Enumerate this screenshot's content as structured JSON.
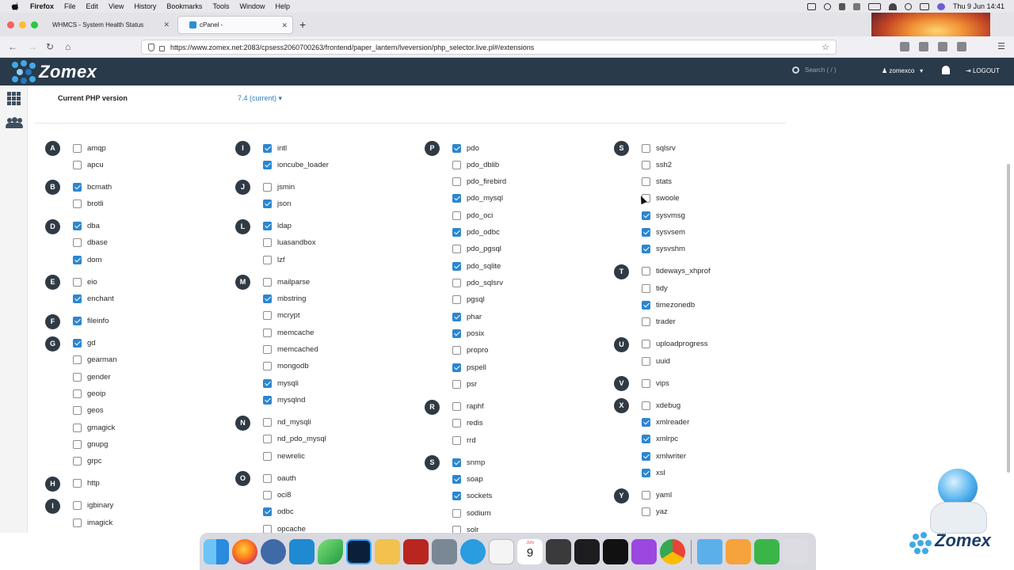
{
  "menubar": {
    "app": "Firefox",
    "items": [
      "File",
      "Edit",
      "View",
      "History",
      "Bookmarks",
      "Tools",
      "Window",
      "Help"
    ],
    "clock": "Thu 9 Jun  14:41"
  },
  "browser": {
    "tabs": [
      {
        "label": "WHMCS - System Health Status",
        "active": false
      },
      {
        "label": "cPanel -",
        "active": true
      }
    ],
    "url": "https://www.zomex.net:2083/cpsess2060700263/frontend/paper_lantern/lveversion/php_selector.live.pl#/extensions"
  },
  "header": {
    "logo": "Zomex",
    "search_placeholder": "Search ( / )",
    "username": "zomexco",
    "logout": "LOGOUT"
  },
  "php": {
    "label": "Current PHP version",
    "value": "7.4 (current)"
  },
  "columns": [
    {
      "groups": [
        {
          "letter": "A",
          "items": [
            {
              "name": "amqp",
              "checked": false
            },
            {
              "name": "apcu",
              "checked": false
            }
          ]
        },
        {
          "letter": "B",
          "items": [
            {
              "name": "bcmath",
              "checked": true
            },
            {
              "name": "brotli",
              "checked": false
            }
          ]
        },
        {
          "letter": "D",
          "items": [
            {
              "name": "dba",
              "checked": true
            },
            {
              "name": "dbase",
              "checked": false
            },
            {
              "name": "dom",
              "checked": true
            }
          ]
        },
        {
          "letter": "E",
          "items": [
            {
              "name": "eio",
              "checked": false
            },
            {
              "name": "enchant",
              "checked": true
            }
          ]
        },
        {
          "letter": "F",
          "items": [
            {
              "name": "fileinfo",
              "checked": true
            }
          ]
        },
        {
          "letter": "G",
          "items": [
            {
              "name": "gd",
              "checked": true
            },
            {
              "name": "gearman",
              "checked": false
            },
            {
              "name": "gender",
              "checked": false
            },
            {
              "name": "geoip",
              "checked": false
            },
            {
              "name": "geos",
              "checked": false
            },
            {
              "name": "gmagick",
              "checked": false
            },
            {
              "name": "gnupg",
              "checked": false
            },
            {
              "name": "grpc",
              "checked": false
            }
          ]
        },
        {
          "letter": "H",
          "items": [
            {
              "name": "http",
              "checked": false
            }
          ]
        },
        {
          "letter": "I",
          "items": [
            {
              "name": "igbinary",
              "checked": false
            },
            {
              "name": "imagick",
              "checked": false
            }
          ]
        }
      ]
    },
    {
      "groups": [
        {
          "letter": "I",
          "items": [
            {
              "name": "intl",
              "checked": true
            },
            {
              "name": "ioncube_loader",
              "checked": true
            }
          ]
        },
        {
          "letter": "J",
          "items": [
            {
              "name": "jsmin",
              "checked": false
            },
            {
              "name": "json",
              "checked": true
            }
          ]
        },
        {
          "letter": "L",
          "items": [
            {
              "name": "ldap",
              "checked": true
            },
            {
              "name": "luasandbox",
              "checked": false
            },
            {
              "name": "lzf",
              "checked": false
            }
          ]
        },
        {
          "letter": "M",
          "items": [
            {
              "name": "mailparse",
              "checked": false
            },
            {
              "name": "mbstring",
              "checked": true
            },
            {
              "name": "mcrypt",
              "checked": false
            },
            {
              "name": "memcache",
              "checked": false
            },
            {
              "name": "memcached",
              "checked": false
            },
            {
              "name": "mongodb",
              "checked": false
            },
            {
              "name": "mysqli",
              "checked": true
            },
            {
              "name": "mysqlnd",
              "checked": true
            }
          ]
        },
        {
          "letter": "N",
          "items": [
            {
              "name": "nd_mysqli",
              "checked": false
            },
            {
              "name": "nd_pdo_mysql",
              "checked": false
            },
            {
              "name": "newrelic",
              "checked": false
            }
          ]
        },
        {
          "letter": "O",
          "items": [
            {
              "name": "oauth",
              "checked": false
            },
            {
              "name": "oci8",
              "checked": false
            },
            {
              "name": "odbc",
              "checked": true
            },
            {
              "name": "opcache",
              "checked": false
            }
          ]
        }
      ]
    },
    {
      "groups": [
        {
          "letter": "P",
          "items": [
            {
              "name": "pdo",
              "checked": true
            },
            {
              "name": "pdo_dblib",
              "checked": false
            },
            {
              "name": "pdo_firebird",
              "checked": false
            },
            {
              "name": "pdo_mysql",
              "checked": true
            },
            {
              "name": "pdo_oci",
              "checked": false
            },
            {
              "name": "pdo_odbc",
              "checked": true
            },
            {
              "name": "pdo_pgsql",
              "checked": false
            },
            {
              "name": "pdo_sqlite",
              "checked": true
            },
            {
              "name": "pdo_sqlsrv",
              "checked": false
            },
            {
              "name": "pgsql",
              "checked": false
            },
            {
              "name": "phar",
              "checked": true
            },
            {
              "name": "posix",
              "checked": true
            },
            {
              "name": "propro",
              "checked": false
            },
            {
              "name": "pspell",
              "checked": true
            },
            {
              "name": "psr",
              "checked": false
            }
          ]
        },
        {
          "letter": "R",
          "items": [
            {
              "name": "raphf",
              "checked": false
            },
            {
              "name": "redis",
              "checked": false
            },
            {
              "name": "rrd",
              "checked": false
            }
          ]
        },
        {
          "letter": "S",
          "items": [
            {
              "name": "snmp",
              "checked": true
            },
            {
              "name": "soap",
              "checked": true
            },
            {
              "name": "sockets",
              "checked": true
            },
            {
              "name": "sodium",
              "checked": false
            },
            {
              "name": "solr",
              "checked": false
            }
          ]
        }
      ]
    },
    {
      "groups": [
        {
          "letter": "S",
          "items": [
            {
              "name": "sqlsrv",
              "checked": false
            },
            {
              "name": "ssh2",
              "checked": false
            },
            {
              "name": "stats",
              "checked": false
            },
            {
              "name": "swoole",
              "checked": false
            },
            {
              "name": "sysvmsg",
              "checked": true
            },
            {
              "name": "sysvsem",
              "checked": true
            },
            {
              "name": "sysvshm",
              "checked": true
            }
          ]
        },
        {
          "letter": "T",
          "items": [
            {
              "name": "tideways_xhprof",
              "checked": false
            },
            {
              "name": "tidy",
              "checked": false
            },
            {
              "name": "timezonedb",
              "checked": true
            },
            {
              "name": "trader",
              "checked": false
            }
          ]
        },
        {
          "letter": "U",
          "items": [
            {
              "name": "uploadprogress",
              "checked": false
            },
            {
              "name": "uuid",
              "checked": false
            }
          ]
        },
        {
          "letter": "V",
          "items": [
            {
              "name": "vips",
              "checked": false
            }
          ]
        },
        {
          "letter": "X",
          "items": [
            {
              "name": "xdebug",
              "checked": false
            },
            {
              "name": "xmlreader",
              "checked": true
            },
            {
              "name": "xmlrpc",
              "checked": true
            },
            {
              "name": "xmlwriter",
              "checked": true
            },
            {
              "name": "xsl",
              "checked": true
            }
          ]
        },
        {
          "letter": "Y",
          "items": [
            {
              "name": "yaml",
              "checked": false
            },
            {
              "name": "yaz",
              "checked": false
            }
          ]
        }
      ]
    }
  ],
  "dock": {
    "calendar_month": "JUN",
    "calendar_day": "9"
  },
  "mascot": {
    "word": "Zomex"
  },
  "colors": {
    "header": "#293a4a",
    "accent": "#2b86d2",
    "badge": "#2f3a44"
  }
}
